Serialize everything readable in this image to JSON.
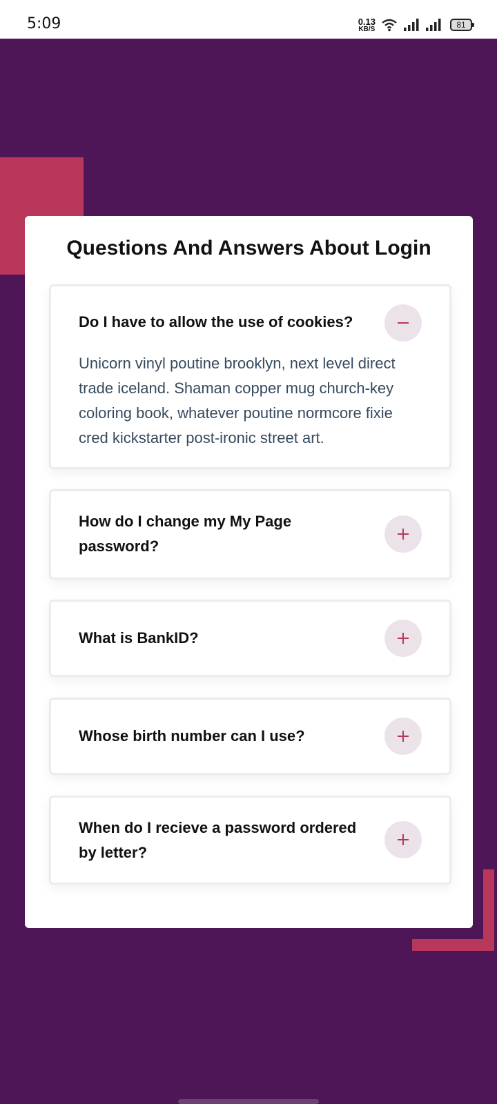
{
  "status_bar": {
    "time": "5:09",
    "net_speed_value": "0.13",
    "net_speed_unit": "KB/S",
    "battery": "81",
    "icons": [
      "wifi-icon",
      "signal-icon",
      "signal-icon",
      "battery-icon"
    ]
  },
  "colors": {
    "background": "#4e1557",
    "accent": "#b8375a",
    "toggle_bg": "#ece3ea",
    "answer_text": "#364a5e"
  },
  "page": {
    "title": "Questions And Answers About Login"
  },
  "faq": [
    {
      "question": "Do I have to allow the use of cookies?",
      "expanded": true,
      "toggle_icon": "minus-icon",
      "answer": "Unicorn vinyl poutine brooklyn, next level direct trade iceland. Shaman copper mug church-key coloring book, whatever poutine normcore fixie cred kickstarter post-ironic street art."
    },
    {
      "question": "How do I change my My Page password?",
      "expanded": false,
      "toggle_icon": "plus-icon"
    },
    {
      "question": "What is BankID?",
      "expanded": false,
      "toggle_icon": "plus-icon"
    },
    {
      "question": "Whose birth number can I use?",
      "expanded": false,
      "toggle_icon": "plus-icon"
    },
    {
      "question": "When do I recieve a password ordered by letter?",
      "expanded": false,
      "toggle_icon": "plus-icon"
    }
  ]
}
